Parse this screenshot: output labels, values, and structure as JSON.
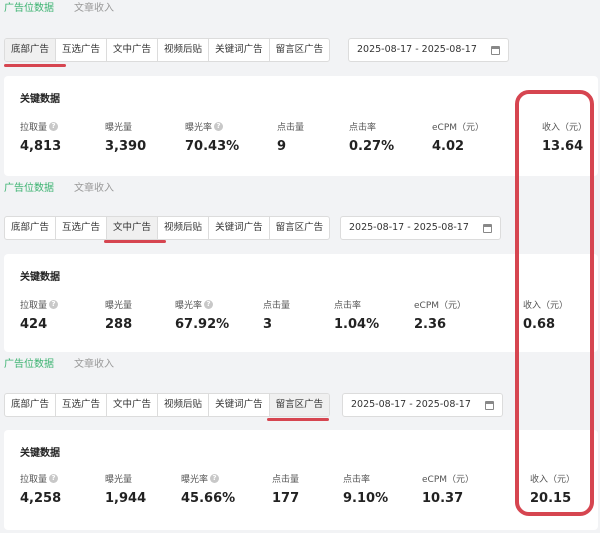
{
  "top_tabs": [
    "广告位数据",
    "文章收入"
  ],
  "ad_tabs": [
    "底部广告",
    "互选广告",
    "文中广告",
    "视频后贴",
    "关键词广告",
    "留言区广告"
  ],
  "card_title": "关键数据",
  "metric_labels": [
    "拉取量",
    "曝光量",
    "曝光率",
    "点击量",
    "点击率",
    "eCPM（元）",
    "收入（元）"
  ],
  "panels": [
    {
      "active_tab": "底部广告",
      "date_range": "2025-08-17 - 2025-08-17",
      "values": [
        "4,813",
        "3,390",
        "70.43%",
        "9",
        "0.27%",
        "4.02",
        "13.64"
      ]
    },
    {
      "active_tab": "文中广告",
      "date_range": "2025-08-17 - 2025-08-17",
      "values": [
        "424",
        "288",
        "67.92%",
        "3",
        "1.04%",
        "2.36",
        "0.68"
      ]
    },
    {
      "active_tab": "留言区广告",
      "date_range": "2025-08-17 - 2025-08-17",
      "values": [
        "4,258",
        "1,944",
        "45.66%",
        "177",
        "9.10%",
        "10.37",
        "20.15"
      ]
    }
  ],
  "annotation_color": "#d64550",
  "accent_color": "#3cb371"
}
